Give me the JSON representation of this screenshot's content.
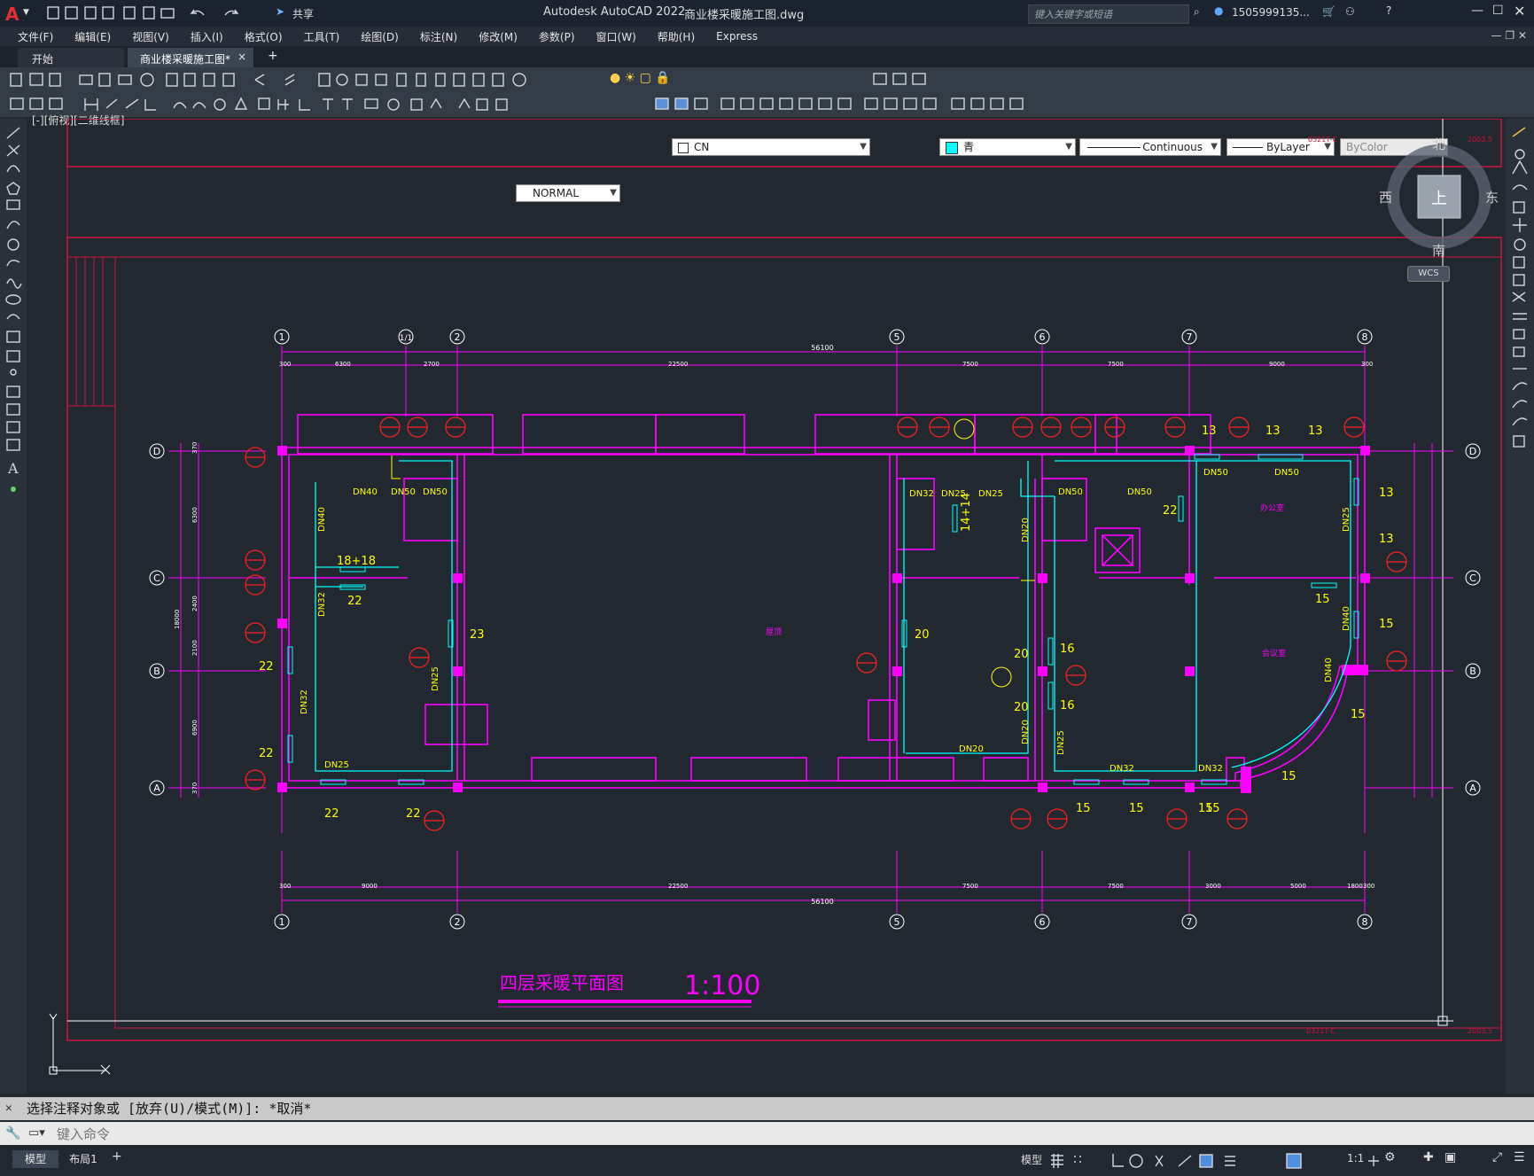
{
  "app": {
    "title": "Autodesk AutoCAD 2022",
    "filename": "商业楼采暖施工图.dwg",
    "share_label": "共享",
    "search_placeholder": "键入关键字或短语",
    "user": "1505999135...",
    "brand_color": "#d9252b"
  },
  "menu": [
    "文件(F)",
    "编辑(E)",
    "视图(V)",
    "插入(I)",
    "格式(O)",
    "工具(T)",
    "绘图(D)",
    "标注(N)",
    "修改(M)",
    "参数(P)",
    "窗口(W)",
    "帮助(H)",
    "Express"
  ],
  "tabs": {
    "start": "开始",
    "doc": "商业楼采暖施工图*",
    "close": "×",
    "add": "+"
  },
  "properties": {
    "layer": "CN",
    "color": "青",
    "linetype": "Continuous",
    "lineweight": "ByLayer",
    "plotstyle": "ByColor",
    "dimstyle": "NORMAL"
  },
  "viewport": {
    "label": "[-][俯视][二维线框]",
    "compass": {
      "north": "北",
      "south": "南",
      "east": "东",
      "west": "西",
      "top": "上",
      "ucs": "WCS"
    },
    "sheet_code": "0321T-C",
    "sheet_year": "2003.5"
  },
  "drawing": {
    "title": "四层采暖平面图",
    "scale": "1:100",
    "total_dim": "56100",
    "grid_top": [
      "1",
      "1/1",
      "2",
      "5",
      "6",
      "7",
      "8"
    ],
    "grid_bottom": [
      "1",
      "2",
      "5",
      "6",
      "7",
      "8"
    ],
    "rows": [
      "D",
      "C",
      "B",
      "A"
    ],
    "top_dims": [
      "300",
      "6300",
      "2700",
      "22500",
      "7500",
      "7500",
      "9000",
      "300"
    ],
    "bottom_dims": [
      "300",
      "9000",
      "22500",
      "7500",
      "7500",
      "3000",
      "5000",
      "1800",
      "300"
    ],
    "left_dims": [
      "370",
      "6300",
      "2400",
      "2100",
      "6900",
      "370"
    ],
    "left_total": "18000",
    "pipes": [
      "DN40",
      "DN50",
      "DN50",
      "DN32",
      "DN25",
      "DN25",
      "DN50",
      "DN50",
      "DN50",
      "DN50",
      "DN40",
      "DN32",
      "DN25",
      "DN20",
      "DN20",
      "DN25",
      "DN32",
      "DN32",
      "DN40",
      "DN25",
      "DN32",
      "DN25"
    ],
    "radiators": [
      "18+18",
      "22",
      "23",
      "22",
      "22",
      "22",
      "22",
      "20",
      "14+14",
      "20",
      "20",
      "16",
      "16",
      "22",
      "13",
      "13",
      "13",
      "13",
      "13",
      "15",
      "15",
      "15",
      "15",
      "15",
      "15",
      "15",
      "15"
    ],
    "room_labels": [
      "屋顶",
      "办公室",
      "会议室"
    ]
  },
  "command": {
    "history": "选择注释对象或 [放弃(U)/模式(M)]: *取消*",
    "placeholder": "键入命令"
  },
  "status": {
    "model_tab": "模型",
    "layout_tab": "布局1",
    "add": "+",
    "space": "模型",
    "scale": "1:1"
  },
  "colors": {
    "magenta": "#ff00ff",
    "cyan": "#00ffff",
    "yellow": "#ffff00",
    "red": "#ff0000",
    "white": "#ffffff",
    "bg": "#212830"
  }
}
